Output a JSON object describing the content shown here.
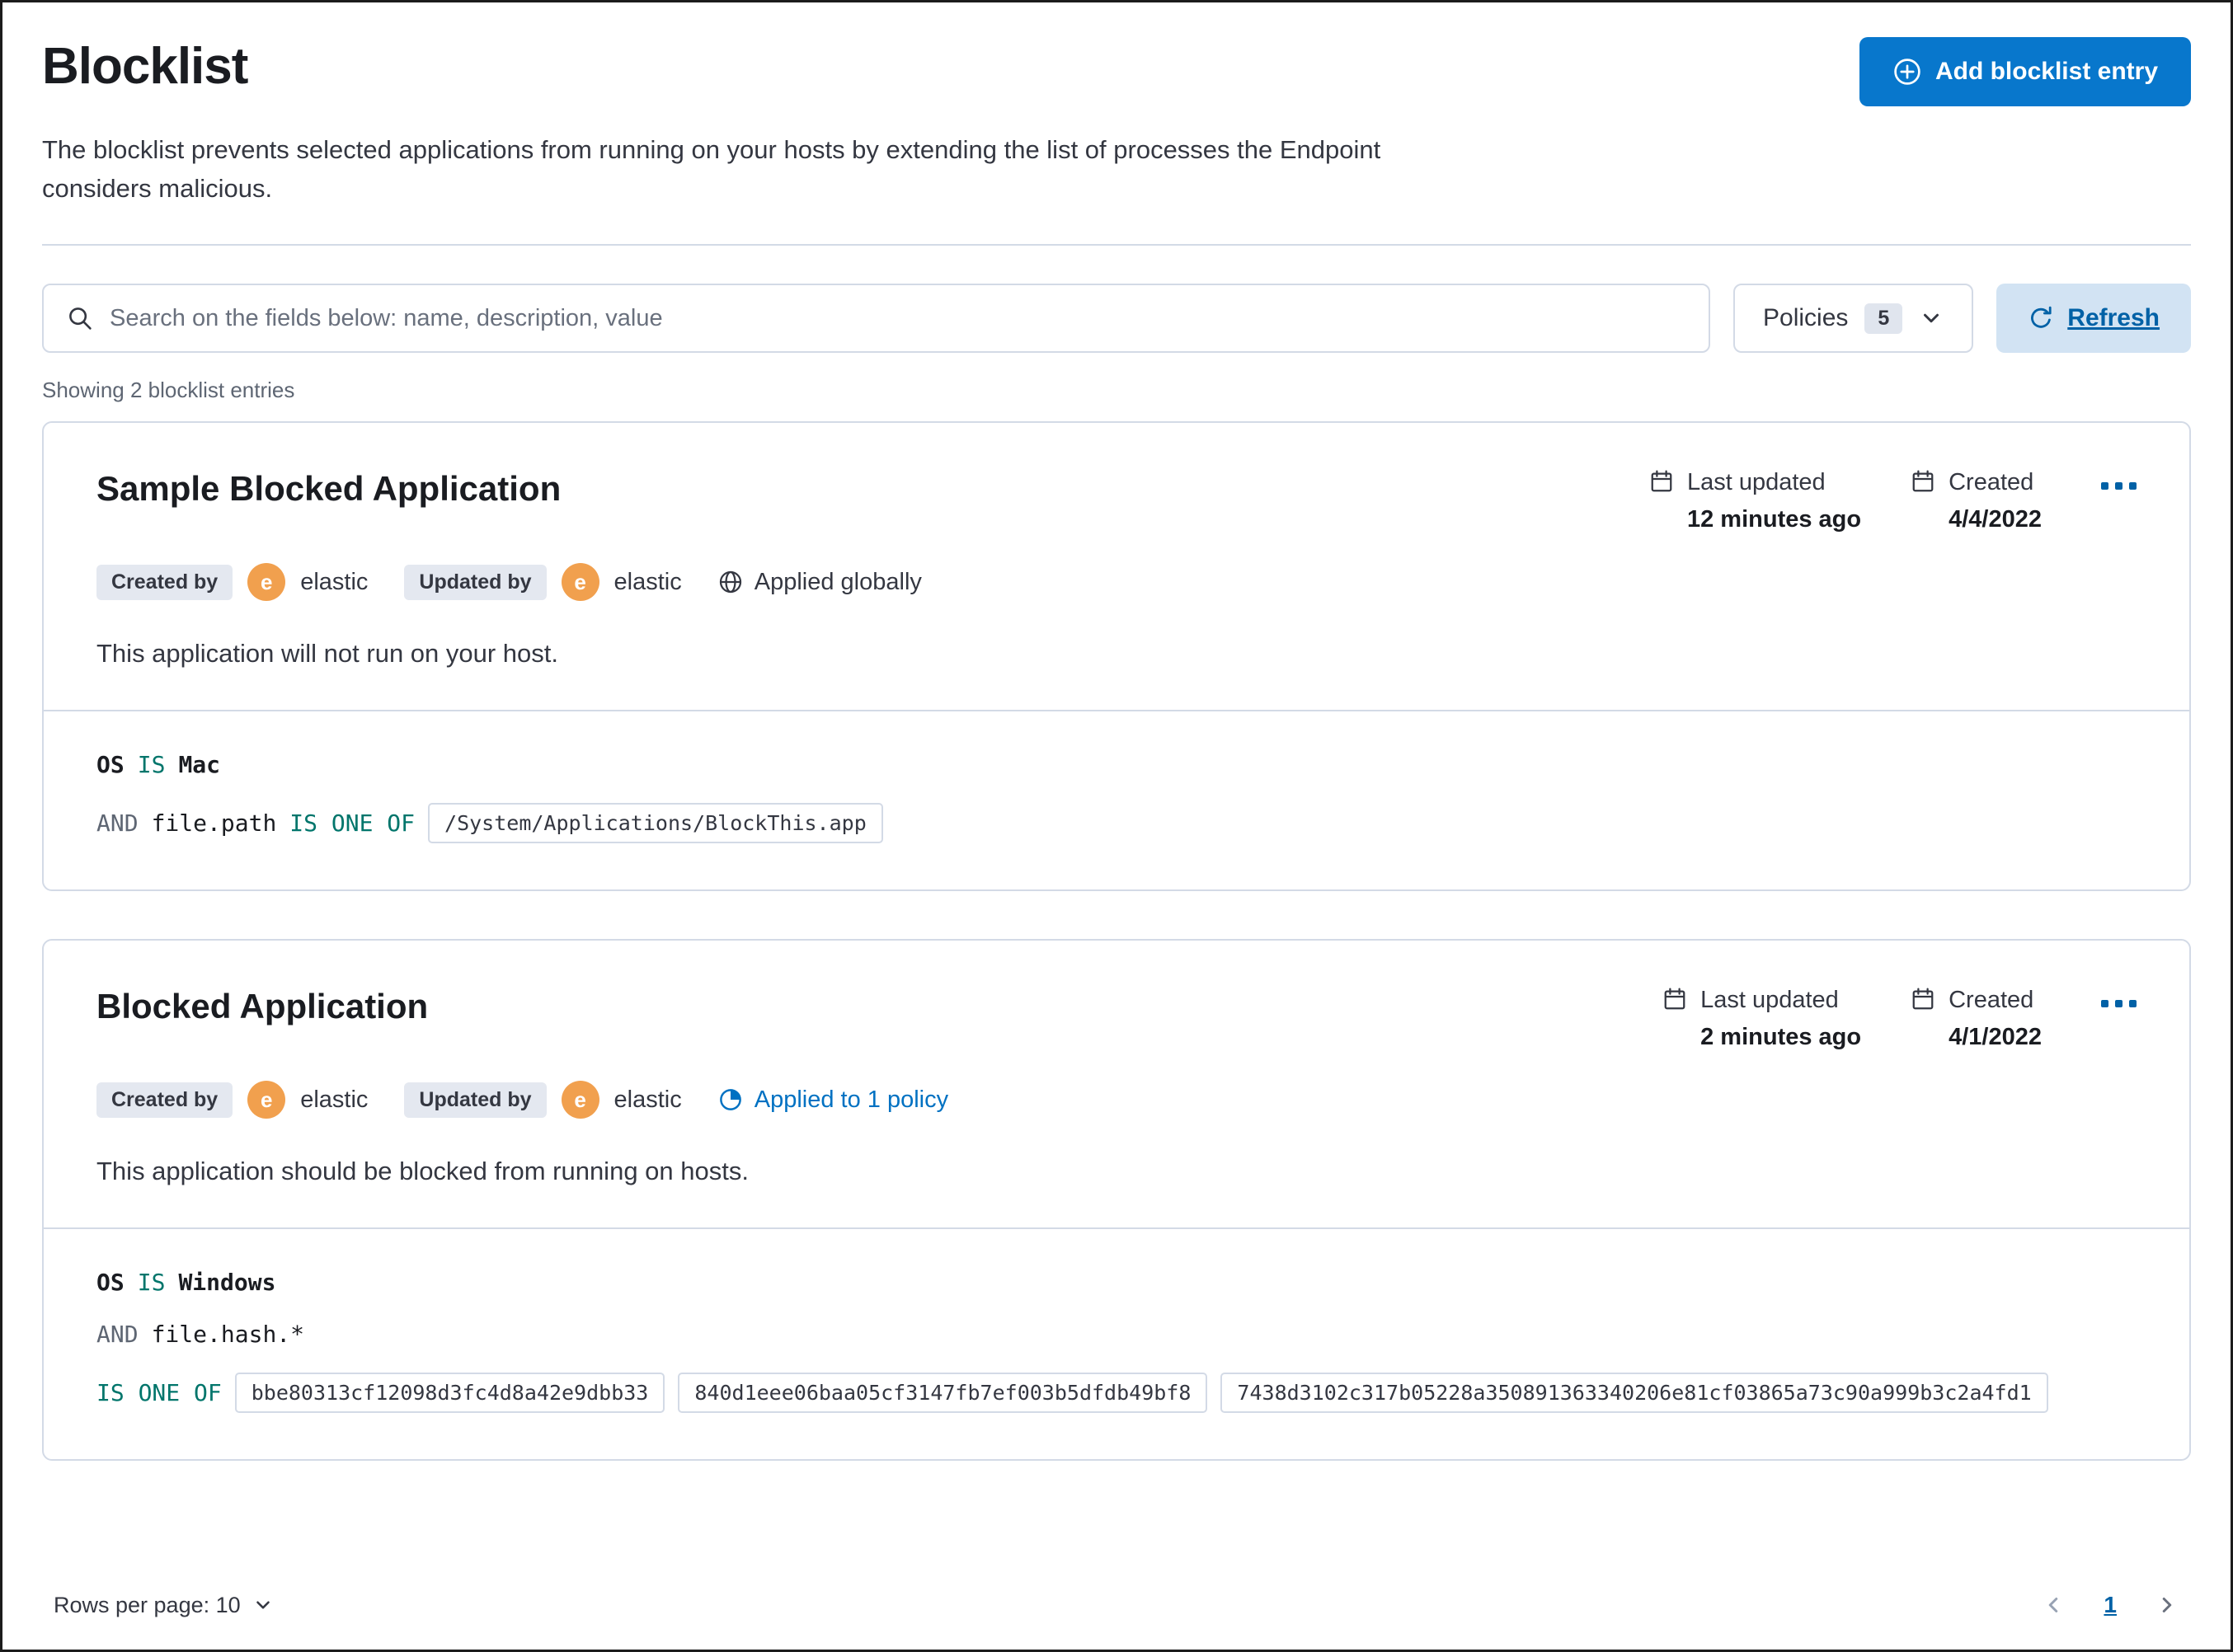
{
  "colors": {
    "primary_button": "#0877CC",
    "link_blue": "#0061A6",
    "operator_teal": "#00756B",
    "avatar_orange": "#F1A04E"
  },
  "header": {
    "title": "Blocklist",
    "add_button_label": "Add blocklist entry",
    "description": "The blocklist prevents selected applications from running on your hosts by extending the list of processes the Endpoint considers malicious."
  },
  "toolbar": {
    "search_placeholder": "Search on the fields below: name, description, value",
    "policies_label": "Policies",
    "policies_count": "5",
    "refresh_label": "Refresh"
  },
  "list": {
    "showing_text": "Showing 2 blocklist entries"
  },
  "cards": [
    {
      "title": "Sample Blocked Application",
      "last_updated_label": "Last updated",
      "last_updated_value": "12 minutes ago",
      "created_label": "Created",
      "created_value": "4/4/2022",
      "created_by_label": "Created by",
      "created_by_name": "elastic",
      "updated_by_label": "Updated by",
      "updated_by_name": "elastic",
      "avatar_initial": "e",
      "scope_label": "Applied globally",
      "description": "This application will not run on your host.",
      "criteria": {
        "os_field": "OS",
        "os_operator": "IS",
        "os_value": "Mac",
        "and_label": "AND",
        "field": "file.path",
        "operator": "IS ONE OF",
        "values": [
          "/System/Applications/BlockThis.app"
        ]
      }
    },
    {
      "title": "Blocked Application",
      "last_updated_label": "Last updated",
      "last_updated_value": "2 minutes ago",
      "created_label": "Created",
      "created_value": "4/1/2022",
      "created_by_label": "Created by",
      "created_by_name": "elastic",
      "updated_by_label": "Updated by",
      "updated_by_name": "elastic",
      "avatar_initial": "e",
      "scope_label": "Applied to 1 policy",
      "description": "This application should be blocked from running on hosts.",
      "criteria": {
        "os_field": "OS",
        "os_operator": "IS",
        "os_value": "Windows",
        "and_label": "AND",
        "field": "file.hash.*",
        "operator": "IS ONE OF",
        "values": [
          "bbe80313cf12098d3fc4d8a42e9dbb33",
          "840d1eee06baa05cf3147fb7ef003b5dfdb49bf8",
          "7438d3102c317b05228a350891363340206e81cf03865a73c90a999b3c2a4fd1"
        ]
      }
    }
  ],
  "footer": {
    "rows_per_page_label": "Rows per page: 10",
    "current_page": "1"
  }
}
